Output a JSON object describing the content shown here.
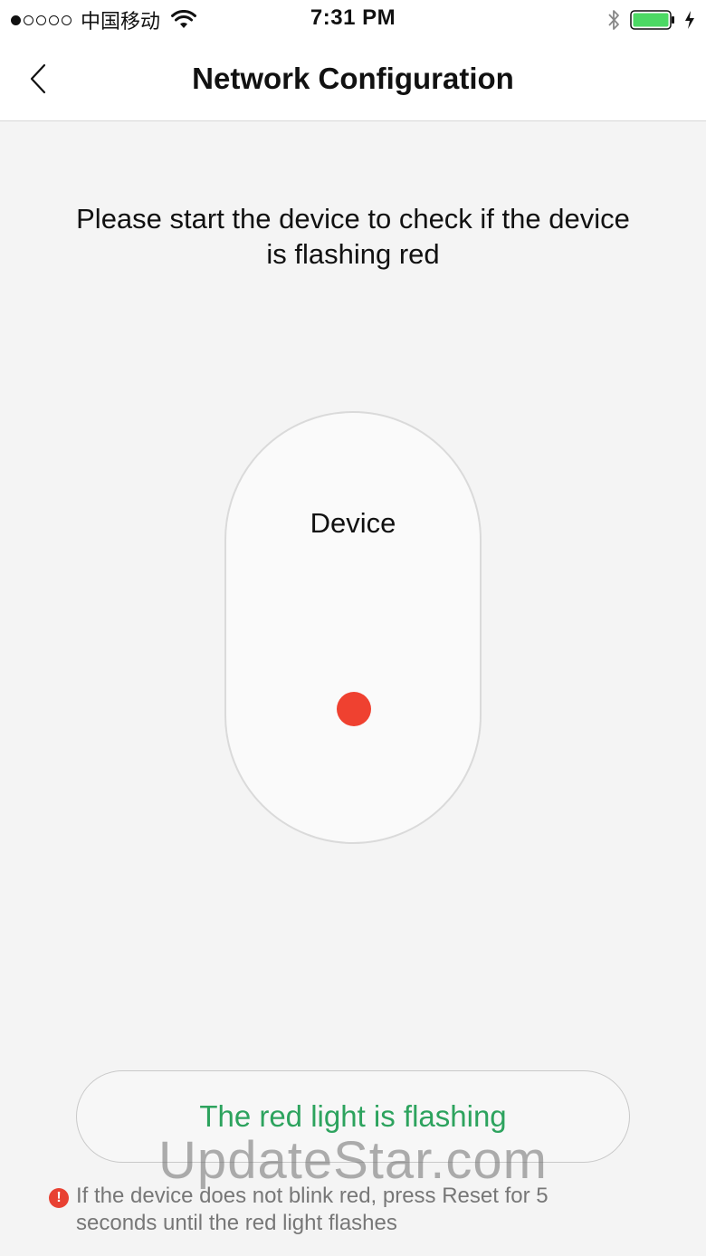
{
  "status_bar": {
    "carrier": "中国移动",
    "time": "7:31 PM",
    "signal_strength": 1,
    "signal_max": 5,
    "battery_color": "#4cd964"
  },
  "nav": {
    "title": "Network Configuration",
    "back_icon": "chevron-left-icon"
  },
  "instruction": "Please start the device to check if the device is flashing red",
  "device": {
    "label": "Device",
    "light_color": "#ef4130"
  },
  "confirm_button": {
    "label": "The red light is flashing",
    "label_color": "#2da35e"
  },
  "hint": {
    "icon": "warning-icon",
    "text": "If the device does not blink red, press Reset for 5 seconds until the red light flashes"
  },
  "watermark": "UpdateStar.com"
}
